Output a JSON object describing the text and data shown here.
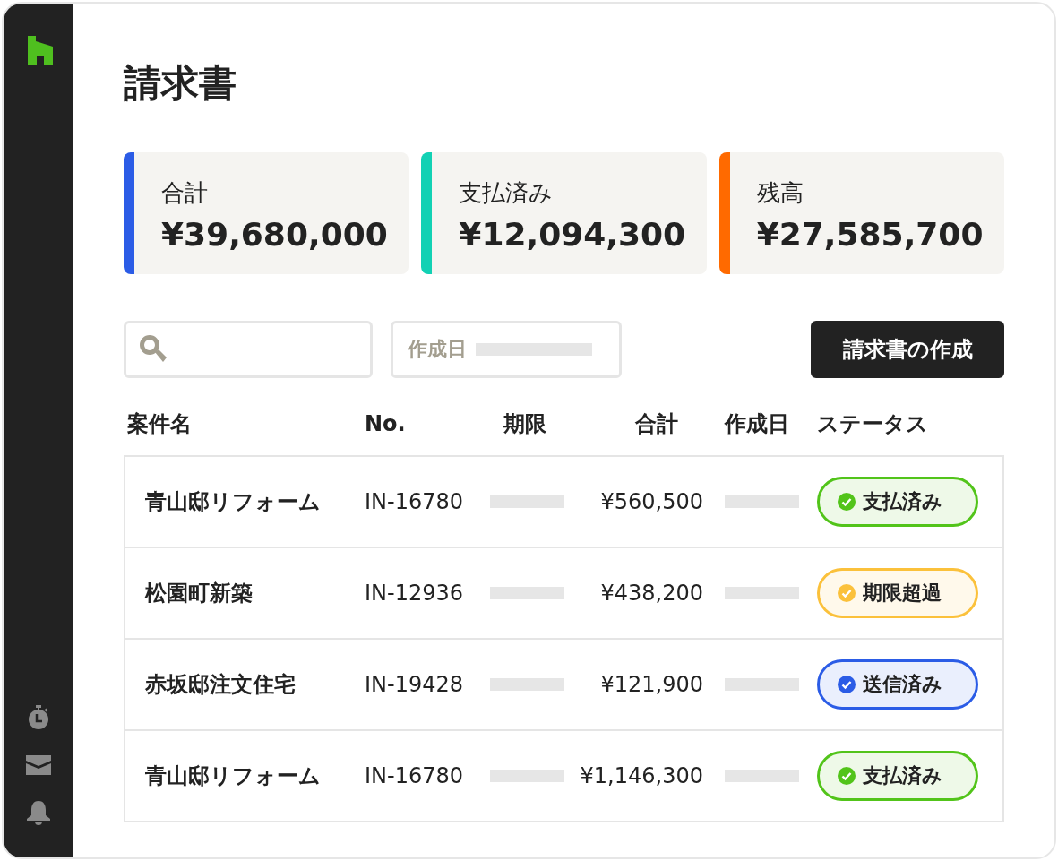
{
  "title": "請求書",
  "summary": [
    {
      "label": "合計",
      "value": "¥39,680,000",
      "color": "#2b5ce6"
    },
    {
      "label": "支払済み",
      "value": "¥12,094,300",
      "color": "#12d1b4"
    },
    {
      "label": "残高",
      "value": "¥27,585,700",
      "color": "#ff6a00"
    }
  ],
  "date_filter": {
    "label": "作成日"
  },
  "create_button": "請求書の作成",
  "columns": [
    "案件名",
    "No.",
    "期限",
    "合計",
    "作成日",
    "ステータス"
  ],
  "rows": [
    {
      "name": "青山邸リフォーム",
      "number": "IN-16780",
      "total": "¥560,500",
      "status": {
        "label": "支払済み",
        "color": "#52c41a"
      }
    },
    {
      "name": "松園町新築",
      "number": "IN-12936",
      "total": "¥438,200",
      "status": {
        "label": "期限超過",
        "color": "#fbc13b"
      }
    },
    {
      "name": "赤坂邸注文住宅",
      "number": "IN-19428",
      "total": "¥121,900",
      "status": {
        "label": "送信済み",
        "color": "#2b5ce6"
      }
    },
    {
      "name": "青山邸リフォーム",
      "number": "IN-16780",
      "total": "¥1,146,300",
      "status": {
        "label": "支払済み",
        "color": "#52c41a"
      }
    }
  ]
}
